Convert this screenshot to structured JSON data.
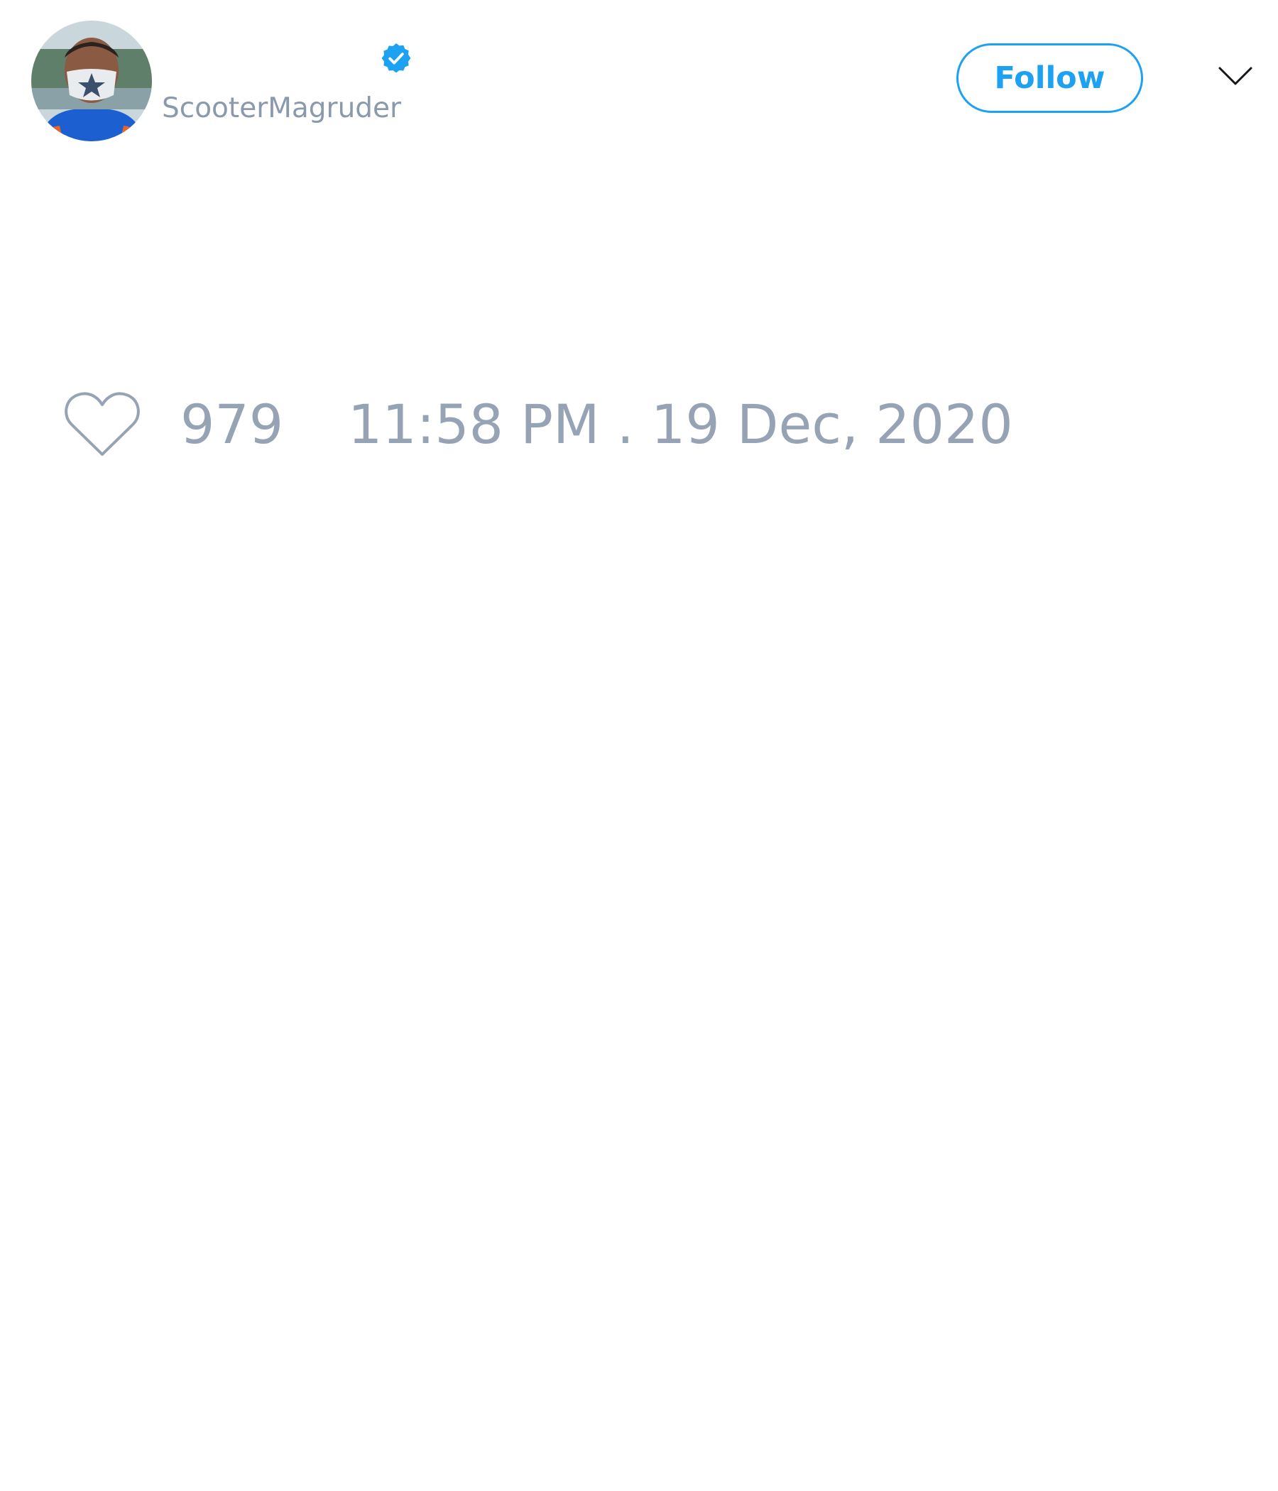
{
  "tweet": {
    "author": {
      "handle": "ScooterMagruder",
      "avatar_icon": "profile-photo-masked-person",
      "verified": true,
      "verified_icon": "verified-badge-icon"
    },
    "follow_label": "Follow",
    "menu_icon": "chevron-down-icon",
    "like_icon": "heart-outline-icon",
    "like_count": "979",
    "timestamp": "11:58 PM . 19 Dec, 2020"
  },
  "colors": {
    "accent": "#1da1f2",
    "muted_text": "#95a3b4",
    "background": "#ffffff"
  }
}
